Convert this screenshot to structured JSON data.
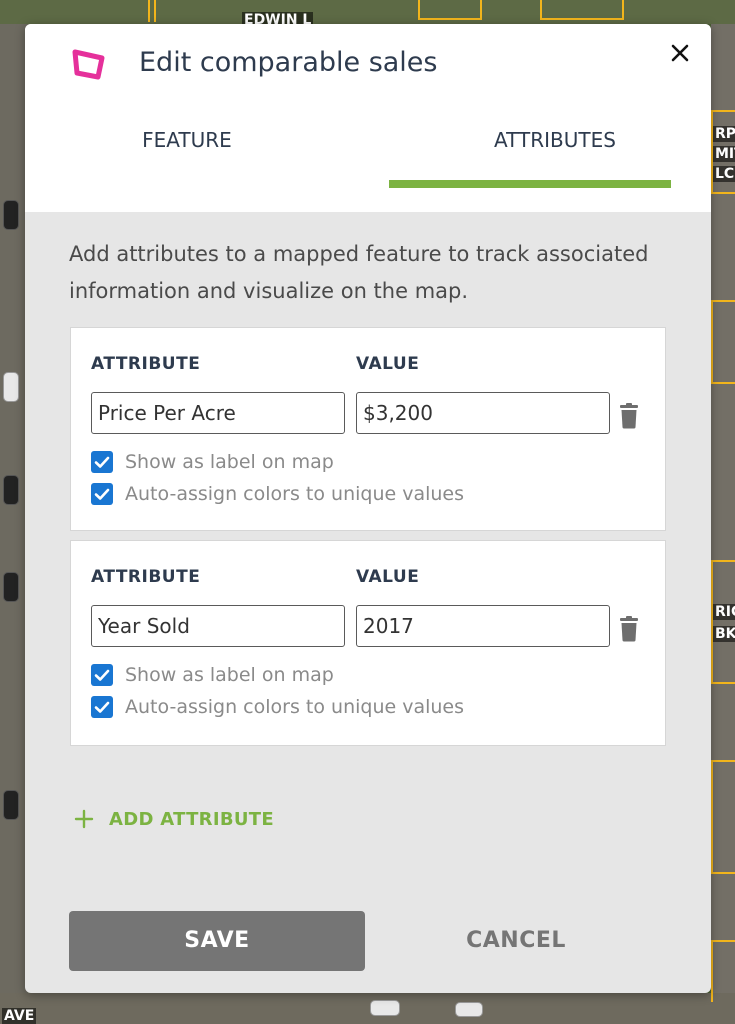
{
  "map": {
    "street_top": "EDWIN L",
    "right_labels": [
      "RPR",
      "MIT",
      "LC"
    ],
    "right_labels_lower": [
      "RIC",
      "BK"
    ],
    "street_bottom": "AVE"
  },
  "dialog": {
    "title": "Edit comparable sales",
    "close_label": "×",
    "icon": "polygon-icon",
    "accent_color": "#7cb342",
    "icon_color": "#e5309b",
    "checkbox_color": "#1976d2",
    "tabs": [
      {
        "label": "FEATURE",
        "active": false
      },
      {
        "label": "ATTRIBUTES",
        "active": true
      }
    ],
    "intro": "Add attributes to a mapped feature to track associated information and visualize on the map.",
    "column_labels": {
      "attribute": "ATTRIBUTE",
      "value": "VALUE"
    },
    "attributes": [
      {
        "attribute": "Price Per Acre",
        "value": "$3,200",
        "show_label": {
          "checked": true,
          "label": "Show as label on map"
        },
        "auto_colors": {
          "checked": true,
          "label": "Auto-assign colors to unique values"
        }
      },
      {
        "attribute": "Year Sold",
        "value": "2017",
        "show_label": {
          "checked": true,
          "label": "Show as label on map"
        },
        "auto_colors": {
          "checked": true,
          "label": "Auto-assign colors to unique values"
        }
      }
    ],
    "add_attribute_label": "ADD ATTRIBUTE",
    "save_label": "SAVE",
    "cancel_label": "CANCEL"
  }
}
